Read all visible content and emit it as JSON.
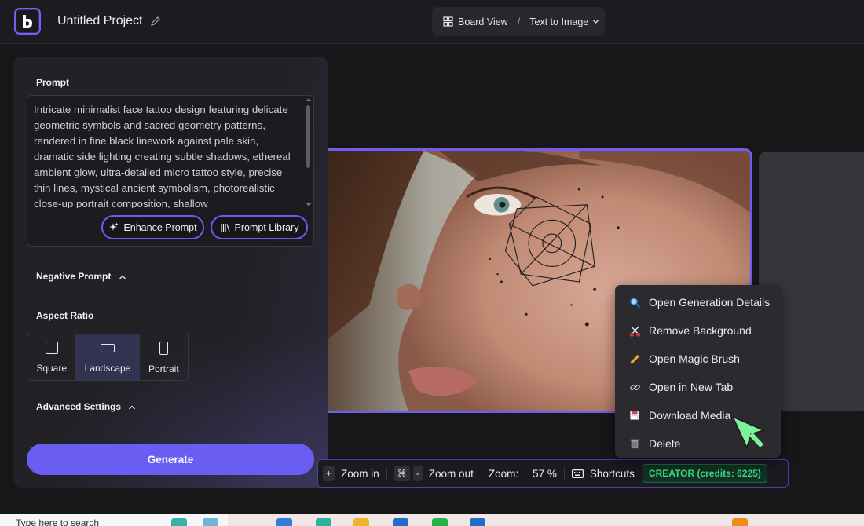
{
  "header": {
    "project_title": "Untitled Project",
    "view_label": "Board View",
    "separator": "/",
    "mode_label": "Text to Image"
  },
  "prompt_panel": {
    "prompt_label": "Prompt",
    "prompt_text": "Intricate minimalist face tattoo design featuring delicate geometric symbols and sacred geometry patterns, rendered in fine black linework against pale skin, dramatic side lighting creating subtle shadows, ethereal ambient glow, ultra-detailed micro tattoo style, precise thin lines, mystical ancient symbolism, photorealistic close-up portrait composition, shallow",
    "enhance_prompt": "Enhance Prompt",
    "prompt_library": "Prompt Library",
    "negative_prompt_label": "Negative Prompt",
    "aspect_ratio_label": "Aspect Ratio",
    "aspect_options": [
      "Square",
      "Landscape",
      "Portrait"
    ],
    "aspect_selected": "Landscape",
    "advanced_settings_label": "Advanced Settings",
    "generate_label": "Generate"
  },
  "context_menu": {
    "items": [
      {
        "label": "Open Generation Details",
        "icon": "magnifier-icon"
      },
      {
        "label": "Remove Background",
        "icon": "scissors-icon"
      },
      {
        "label": "Open Magic Brush",
        "icon": "pencil-icon"
      },
      {
        "label": "Open in New Tab",
        "icon": "link-icon"
      },
      {
        "label": "Download Media",
        "icon": "floppy-disk-icon"
      },
      {
        "label": "Delete",
        "icon": "wastebasket-icon"
      }
    ]
  },
  "toolbar": {
    "zoom_in_key": "+",
    "zoom_in_label": "Zoom in",
    "zoom_out_key1": "⌘",
    "zoom_out_key2": "-",
    "zoom_out_label": "Zoom out",
    "zoom_label": "Zoom:",
    "zoom_value": "57 %",
    "shortcuts_label": "Shortcuts",
    "credits_badge": "CREATOR (credits: 6225)"
  },
  "taskbar": {
    "search_placeholder": "Type here to search"
  },
  "colors": {
    "accent": "#6a5ef2",
    "credits_green": "#3ddc84",
    "background": "#17171a",
    "panel": "#212126"
  }
}
